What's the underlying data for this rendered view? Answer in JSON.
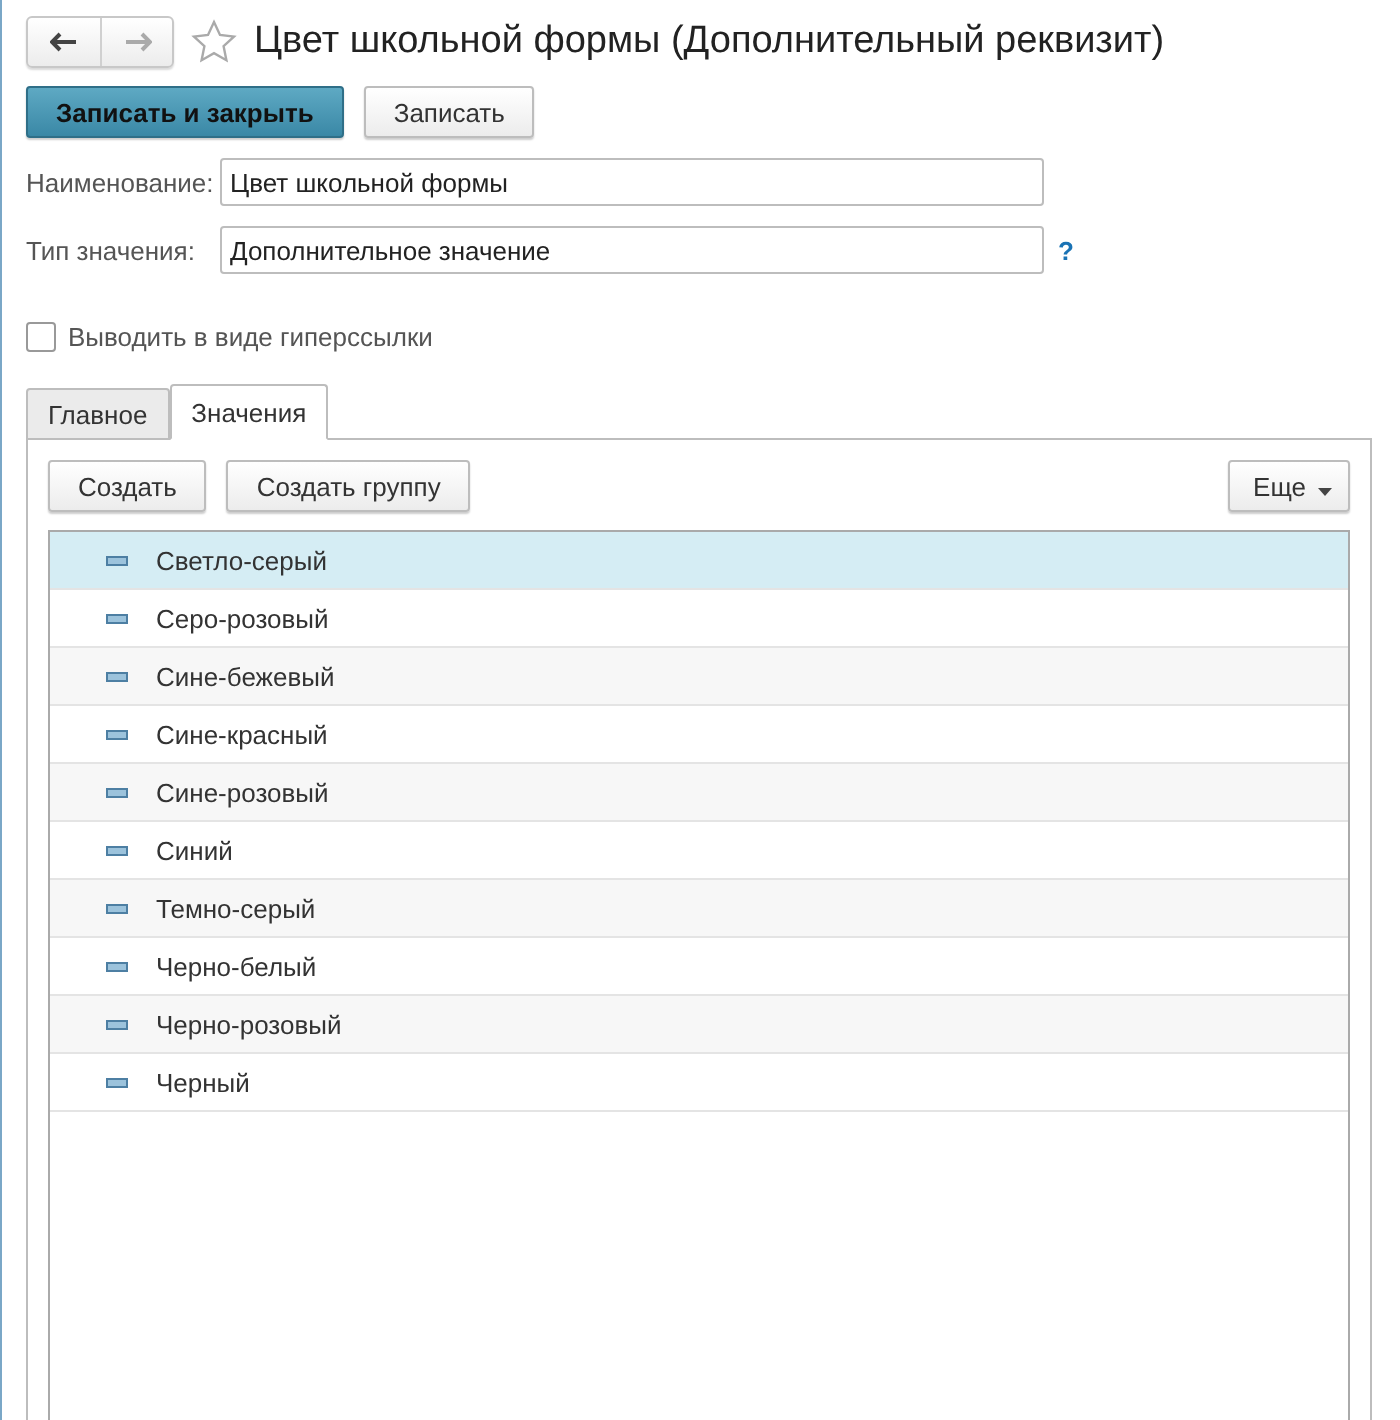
{
  "window": {
    "title": "Цвет школьной формы (Дополнительный реквизит)",
    "favorite": false
  },
  "nav": {
    "back_enabled": true,
    "forward_enabled": false
  },
  "buttons": [
    {
      "label": "Записать и закрыть",
      "kind": "primary"
    },
    {
      "label": "Записать",
      "kind": "normal"
    }
  ],
  "fields": [
    {
      "label": "Наименование:",
      "value": "Цвет школьной формы"
    },
    {
      "label": "Тип значения:",
      "value": "Дополнительное значение",
      "help": "?"
    }
  ],
  "hyperlink_checkbox": {
    "label": "Выводить в виде гиперссылки",
    "checked": false
  },
  "tabs": [
    {
      "label": "Главное",
      "selected": false
    },
    {
      "label": "Значения",
      "selected": true
    }
  ],
  "toolbar": {
    "left": [
      "Создать",
      "Создать группу"
    ],
    "more": "Еще"
  },
  "values": [
    {
      "name": "Светло-серый",
      "selected": true
    },
    {
      "name": "Серо-розовый",
      "selected": false
    },
    {
      "name": "Сине-бежевый",
      "selected": false
    },
    {
      "name": "Сине-красный",
      "selected": false
    },
    {
      "name": "Сине-розовый",
      "selected": false
    },
    {
      "name": "Синий",
      "selected": false
    },
    {
      "name": "Темно-серый",
      "selected": false
    },
    {
      "name": "Черно-белый",
      "selected": false
    },
    {
      "name": "Черно-розовый",
      "selected": false
    },
    {
      "name": "Черный",
      "selected": false
    }
  ]
}
